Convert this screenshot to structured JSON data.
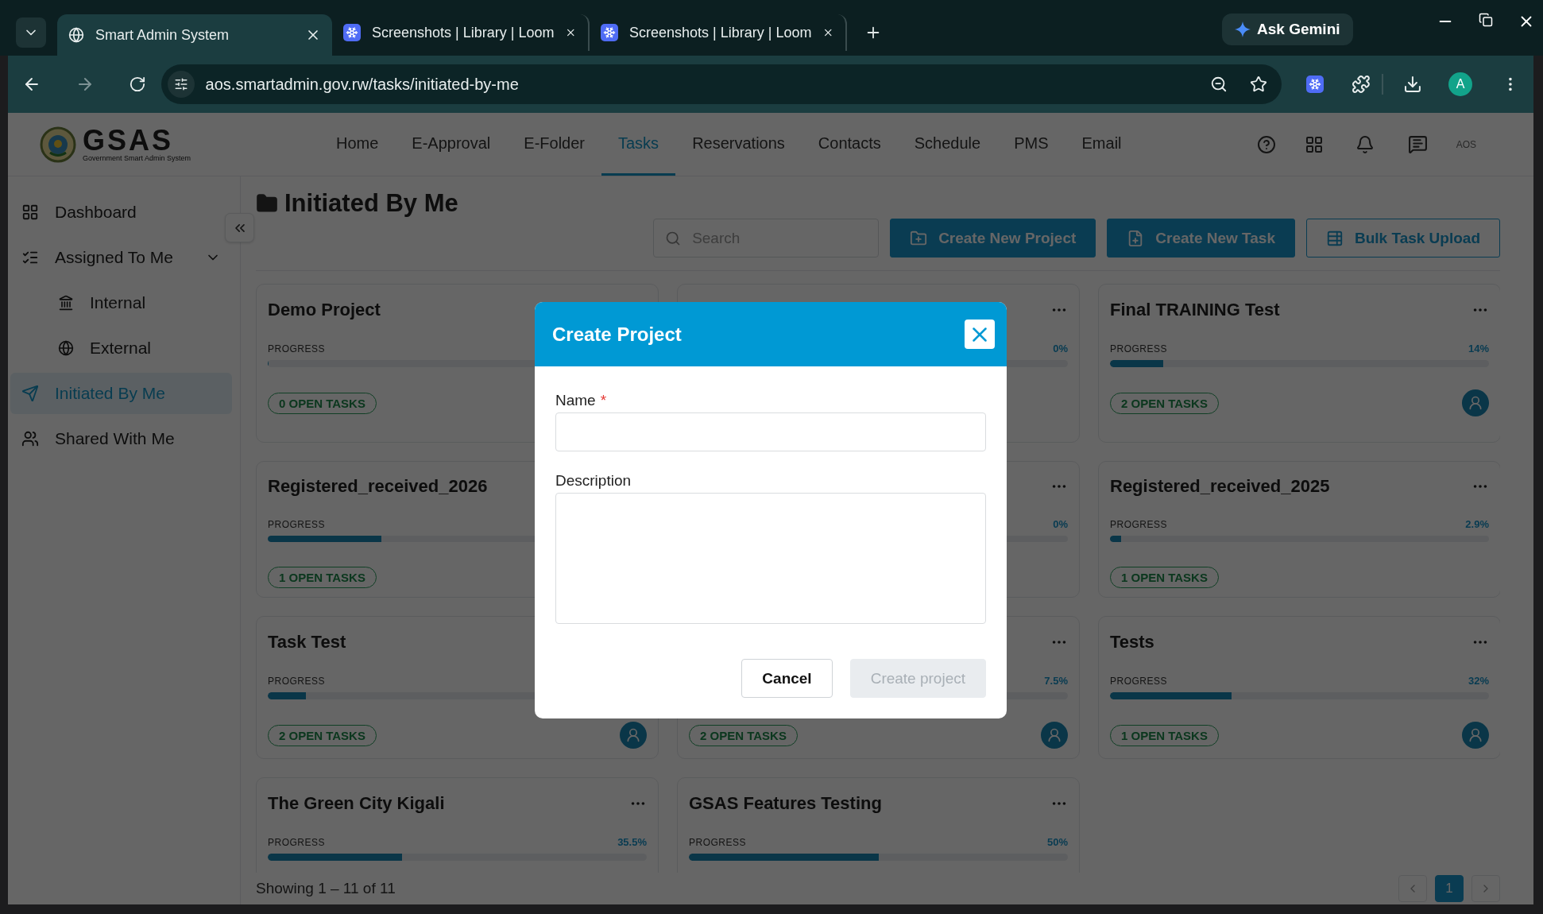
{
  "browser": {
    "tabs": [
      {
        "title": "Smart Admin System",
        "selected": true,
        "kind": "site"
      },
      {
        "title": "Screenshots | Library | Loom",
        "selected": false,
        "kind": "loom"
      },
      {
        "title": "Screenshots | Library | Loom",
        "selected": false,
        "kind": "loom"
      }
    ],
    "gemini": "Ask Gemini",
    "url": "aos.smartadmin.gov.rw/tasks/initiated-by-me",
    "profile": "A"
  },
  "header": {
    "logo": "GSAS",
    "logo_subtitle": "Government Smart Admin System",
    "nav": [
      {
        "label": "Home",
        "selected": false
      },
      {
        "label": "E-Approval",
        "selected": false
      },
      {
        "label": "E-Folder",
        "selected": false
      },
      {
        "label": "Tasks",
        "selected": true
      },
      {
        "label": "Reservations",
        "selected": false
      },
      {
        "label": "Contacts",
        "selected": false
      },
      {
        "label": "Schedule",
        "selected": false
      },
      {
        "label": "PMS",
        "selected": false
      },
      {
        "label": "Email",
        "selected": false
      }
    ],
    "user": "AOS"
  },
  "sidebar": {
    "items": [
      {
        "label": "Dashboard",
        "selected": false
      },
      {
        "label": "Assigned To Me",
        "selected": false,
        "expanded": true,
        "children": [
          {
            "label": "Internal",
            "selected": false
          },
          {
            "label": "External",
            "selected": false
          }
        ]
      },
      {
        "label": "Initiated By Me",
        "selected": true
      },
      {
        "label": "Shared With Me",
        "selected": false
      }
    ]
  },
  "page": {
    "title": "Initiated By Me",
    "search": {
      "placeholder": "Search"
    },
    "buttons": [
      {
        "label": "Create New Project",
        "kind": "primary"
      },
      {
        "label": "Create New Task",
        "kind": "primary"
      },
      {
        "label": "Bulk Task Upload",
        "kind": "outline"
      }
    ]
  },
  "projects": [
    {
      "title": "Demo Project",
      "progress_label": "PROGRESS",
      "level": 0,
      "open_tasks": "0 OPEN TASKS"
    },
    {
      "percent": "0%",
      "level": 0,
      "has_assignee": false
    },
    {
      "title": "Final TRAINING Test",
      "progress_label": "PROGRESS",
      "percent": "14%",
      "level": 0.14,
      "open_tasks": "2 OPEN TASKS",
      "has_assignee": true
    },
    {
      "title": "Registered_received_2026",
      "progress_label": "PROGRESS",
      "level": 0.3,
      "open_tasks": "1 OPEN TASKS"
    },
    {
      "percent": "0%",
      "level": 0,
      "has_assignee": false
    },
    {
      "title": "Registered_received_2025",
      "progress_label": "PROGRESS",
      "percent": "2.9%",
      "level": 0.029,
      "open_tasks": "1 OPEN TASKS",
      "has_assignee": false
    },
    {
      "title": "Task Test",
      "progress_label": "PROGRESS",
      "level": 0.1,
      "open_tasks": "2 OPEN TASKS",
      "has_assignee": true
    },
    {
      "percent": "7.5%",
      "level": 0.075,
      "open_tasks": "2 OPEN TASKS",
      "has_assignee": true
    },
    {
      "title": "Tests",
      "progress_label": "PROGRESS",
      "percent": "32%",
      "level": 0.32,
      "open_tasks": "1 OPEN TASKS",
      "has_assignee": true
    },
    {
      "title": "The Green City Kigali",
      "progress_label": "PROGRESS",
      "percent": "35.5%",
      "level": 0.355
    },
    {
      "title": "GSAS Features Testing",
      "progress_label": "PROGRESS",
      "percent": "50%",
      "level": 0.5
    }
  ],
  "footer": {
    "summary": "Showing 1 – 11 of 11",
    "pages": [
      {
        "label": "1",
        "selected": true
      }
    ]
  },
  "modal": {
    "title": "Create Project",
    "fields": [
      {
        "label": "Name",
        "required_mark": "*",
        "kind": "input"
      },
      {
        "label": "Description",
        "kind": "textarea"
      }
    ],
    "buttons": [
      {
        "label": "Cancel",
        "kind": "secondary",
        "disabled": false
      },
      {
        "label": "Create project",
        "kind": "primary",
        "disabled": true
      }
    ]
  }
}
